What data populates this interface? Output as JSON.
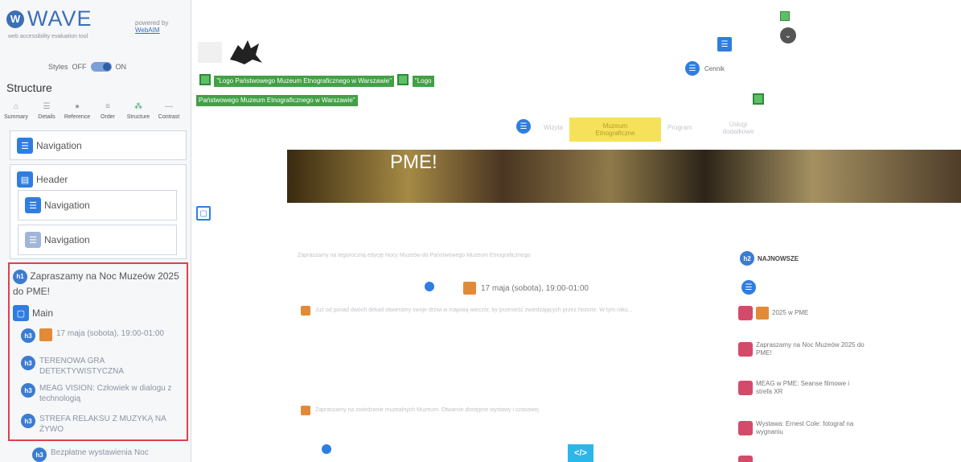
{
  "wave": {
    "logo_text": "WAVE",
    "subtitle": "web accessibility evaluation tool",
    "powered_label": "powered by",
    "powered_link": "WebAIM",
    "styles_label": "Styles",
    "styles_off": "OFF",
    "styles_on": "ON",
    "panel_heading": "Structure",
    "tabs": [
      {
        "label": "Summary",
        "icon": "home-icon"
      },
      {
        "label": "Details",
        "icon": "details-icon"
      },
      {
        "label": "Reference",
        "icon": "reference-icon"
      },
      {
        "label": "Order",
        "icon": "order-icon"
      },
      {
        "label": "Structure",
        "icon": "structure-icon"
      },
      {
        "label": "Contrast",
        "icon": "contrast-icon"
      }
    ],
    "structure": {
      "nav1": "Navigation",
      "header": "Header",
      "header_nav1": "Navigation",
      "header_nav2": "Navigation",
      "h1_label": "Zapraszamy na Noc Muzeów 2025 do PME!",
      "main": "Main",
      "h3_items": [
        "17 maja (sobota), 19:00-01:00",
        "TERENOWA GRA DETEKTYWISTYCZNA",
        "MEAG VISION: Człowiek w dialogu z technologią",
        "STREFA RELAKSU Z MUZYKĄ NA ŻYWO"
      ],
      "last_item": "Bezpłatne wystawienia Noc"
    }
  },
  "site": {
    "logo_link1": "\"Logo Państwowego Muzeum Etnograficznego w Warszawie\"",
    "logo_link2": "\"Logo",
    "logo_link2_cont": "Państwowego Muzeum Etnograficznego w Warszawie\"",
    "cennik": "Cennik",
    "nav": {
      "item1": "Wizyta",
      "item2": "Muzeum Etnograficzne",
      "item3": "Program",
      "item4": "Usługi dodatkowe"
    },
    "hero_title": "PME!",
    "intro": "Zapraszamy na tegoroczną edycję Nocy Muzeów do Państwowego Muzeum Etnograficznego",
    "date_line": "17 maja (sobota), 19:00-01:00",
    "body_text": "Już od ponad dwóch dekad otwieramy swoje drzwi w majową wieczór, by przenieść zwiedzających przez historie. W tym roku...",
    "visit_text": "Zapraszamy na zwiedzanie muzealnych Muzeum. Otwarcie dostępne wystawy i czasowej",
    "latest_heading": "NAJNOWSZE",
    "latest_items": [
      "2025 w PME",
      "Zapraszamy na Noc Muzeów 2025 do PME!",
      "MEAG w PME: Seanse filmowe i strefa XR",
      "Wystawa: Ernest Cole: fotograf na wygnaniu"
    ]
  }
}
